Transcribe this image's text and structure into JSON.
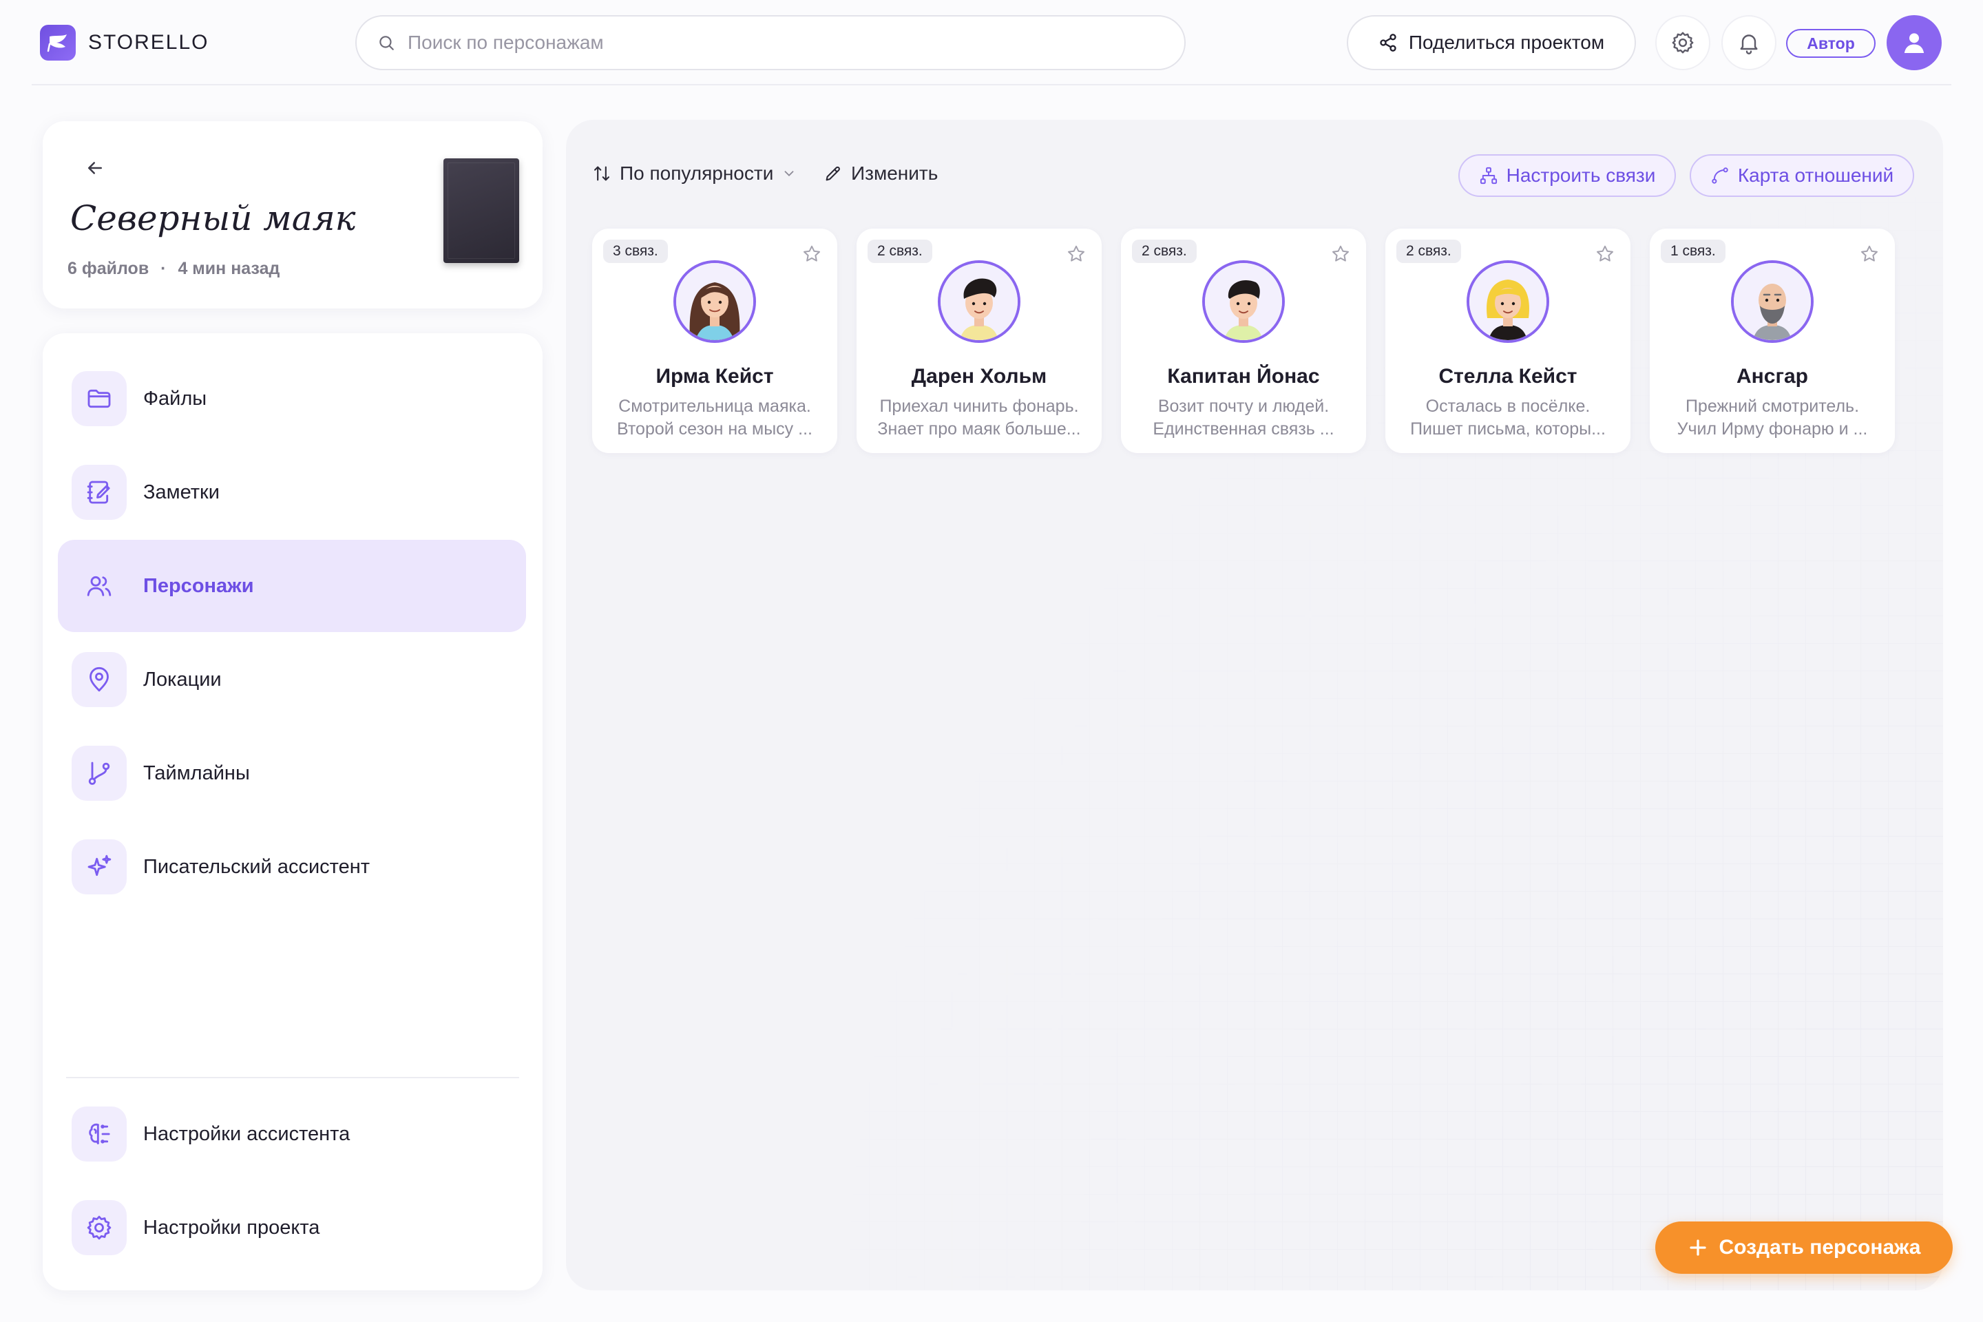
{
  "app": {
    "name": "STORELLO"
  },
  "search": {
    "placeholder": "Поиск по персонажам"
  },
  "header": {
    "share_label": "Поделиться проектом",
    "role_badge": "Автор"
  },
  "project": {
    "title": "Северный маяк",
    "files_count": "6 файлов",
    "meta_separator": "·",
    "updated": "4 мин назад"
  },
  "nav": {
    "items": [
      {
        "label": "Файлы",
        "icon": "folder-icon"
      },
      {
        "label": "Заметки",
        "icon": "notebook-icon"
      },
      {
        "label": "Персонажи",
        "icon": "users-icon",
        "active": true
      },
      {
        "label": "Локации",
        "icon": "map-pin-icon"
      },
      {
        "label": "Таймлайны",
        "icon": "git-branch-icon"
      },
      {
        "label": "Писательский ассистент",
        "icon": "sparkles-icon"
      }
    ],
    "bottom_items": [
      {
        "label": "Настройки ассистента",
        "icon": "brain-settings-icon"
      },
      {
        "label": "Настройки проекта",
        "icon": "gear-icon"
      }
    ]
  },
  "toolbar": {
    "sort_label": "По популярности",
    "edit_label": "Изменить",
    "configure_links_label": "Настроить связи",
    "relations_map_label": "Карта отношений"
  },
  "characters": [
    {
      "badge": "3 связ.",
      "name": "Ирма Кейст",
      "desc_line1": "Смотрительница маяка.",
      "desc_line2": "Второй сезон на мысу ..."
    },
    {
      "badge": "2 связ.",
      "name": "Дарен Хольм",
      "desc_line1": "Приехал чинить фонарь.",
      "desc_line2": "Знает про маяк больше..."
    },
    {
      "badge": "2 связ.",
      "name": "Капитан Йонас",
      "desc_line1": "Возит почту и людей.",
      "desc_line2": "Единственная связь ..."
    },
    {
      "badge": "2 связ.",
      "name": "Стелла Кейст",
      "desc_line1": "Осталась в посёлке.",
      "desc_line2": "Пишет письма, которы..."
    },
    {
      "badge": "1 связ.",
      "name": "Ансгар",
      "desc_line1": "Прежний смотритель.",
      "desc_line2": "Учил Ирму фонарю и ..."
    }
  ],
  "create_button": {
    "label": "Создать персонажа"
  },
  "colors": {
    "accent": "#7b5cf0",
    "accent_light": "#ece6fd",
    "cta": "#f7912a",
    "background": "#fbfbfd"
  }
}
